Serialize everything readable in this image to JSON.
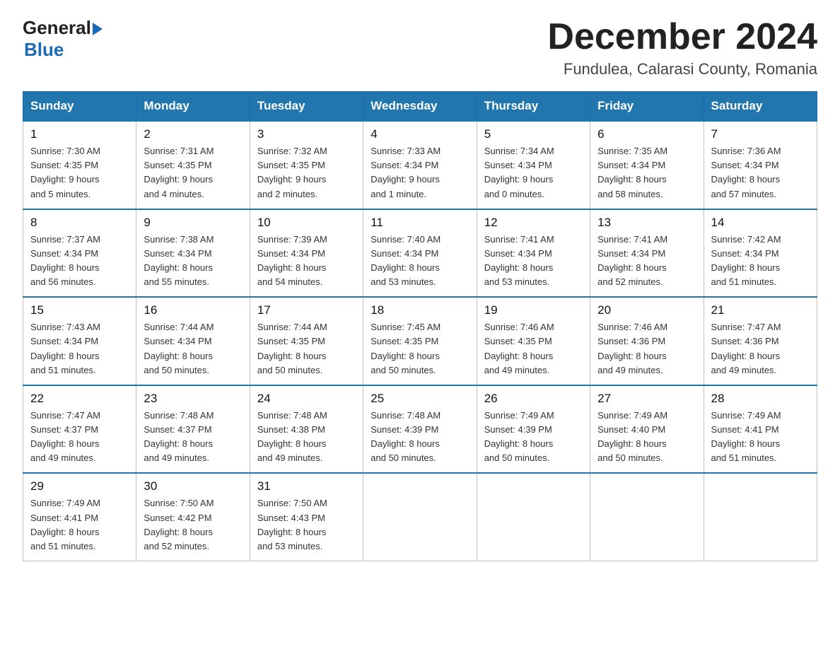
{
  "header": {
    "logo_general": "General",
    "logo_blue": "Blue",
    "title": "December 2024",
    "subtitle": "Fundulea, Calarasi County, Romania"
  },
  "days_of_week": [
    "Sunday",
    "Monday",
    "Tuesday",
    "Wednesday",
    "Thursday",
    "Friday",
    "Saturday"
  ],
  "weeks": [
    [
      {
        "num": "1",
        "sunrise": "7:30 AM",
        "sunset": "4:35 PM",
        "daylight": "9 hours and 5 minutes."
      },
      {
        "num": "2",
        "sunrise": "7:31 AM",
        "sunset": "4:35 PM",
        "daylight": "9 hours and 4 minutes."
      },
      {
        "num": "3",
        "sunrise": "7:32 AM",
        "sunset": "4:35 PM",
        "daylight": "9 hours and 2 minutes."
      },
      {
        "num": "4",
        "sunrise": "7:33 AM",
        "sunset": "4:34 PM",
        "daylight": "9 hours and 1 minute."
      },
      {
        "num": "5",
        "sunrise": "7:34 AM",
        "sunset": "4:34 PM",
        "daylight": "9 hours and 0 minutes."
      },
      {
        "num": "6",
        "sunrise": "7:35 AM",
        "sunset": "4:34 PM",
        "daylight": "8 hours and 58 minutes."
      },
      {
        "num": "7",
        "sunrise": "7:36 AM",
        "sunset": "4:34 PM",
        "daylight": "8 hours and 57 minutes."
      }
    ],
    [
      {
        "num": "8",
        "sunrise": "7:37 AM",
        "sunset": "4:34 PM",
        "daylight": "8 hours and 56 minutes."
      },
      {
        "num": "9",
        "sunrise": "7:38 AM",
        "sunset": "4:34 PM",
        "daylight": "8 hours and 55 minutes."
      },
      {
        "num": "10",
        "sunrise": "7:39 AM",
        "sunset": "4:34 PM",
        "daylight": "8 hours and 54 minutes."
      },
      {
        "num": "11",
        "sunrise": "7:40 AM",
        "sunset": "4:34 PM",
        "daylight": "8 hours and 53 minutes."
      },
      {
        "num": "12",
        "sunrise": "7:41 AM",
        "sunset": "4:34 PM",
        "daylight": "8 hours and 53 minutes."
      },
      {
        "num": "13",
        "sunrise": "7:41 AM",
        "sunset": "4:34 PM",
        "daylight": "8 hours and 52 minutes."
      },
      {
        "num": "14",
        "sunrise": "7:42 AM",
        "sunset": "4:34 PM",
        "daylight": "8 hours and 51 minutes."
      }
    ],
    [
      {
        "num": "15",
        "sunrise": "7:43 AM",
        "sunset": "4:34 PM",
        "daylight": "8 hours and 51 minutes."
      },
      {
        "num": "16",
        "sunrise": "7:44 AM",
        "sunset": "4:34 PM",
        "daylight": "8 hours and 50 minutes."
      },
      {
        "num": "17",
        "sunrise": "7:44 AM",
        "sunset": "4:35 PM",
        "daylight": "8 hours and 50 minutes."
      },
      {
        "num": "18",
        "sunrise": "7:45 AM",
        "sunset": "4:35 PM",
        "daylight": "8 hours and 50 minutes."
      },
      {
        "num": "19",
        "sunrise": "7:46 AM",
        "sunset": "4:35 PM",
        "daylight": "8 hours and 49 minutes."
      },
      {
        "num": "20",
        "sunrise": "7:46 AM",
        "sunset": "4:36 PM",
        "daylight": "8 hours and 49 minutes."
      },
      {
        "num": "21",
        "sunrise": "7:47 AM",
        "sunset": "4:36 PM",
        "daylight": "8 hours and 49 minutes."
      }
    ],
    [
      {
        "num": "22",
        "sunrise": "7:47 AM",
        "sunset": "4:37 PM",
        "daylight": "8 hours and 49 minutes."
      },
      {
        "num": "23",
        "sunrise": "7:48 AM",
        "sunset": "4:37 PM",
        "daylight": "8 hours and 49 minutes."
      },
      {
        "num": "24",
        "sunrise": "7:48 AM",
        "sunset": "4:38 PM",
        "daylight": "8 hours and 49 minutes."
      },
      {
        "num": "25",
        "sunrise": "7:48 AM",
        "sunset": "4:39 PM",
        "daylight": "8 hours and 50 minutes."
      },
      {
        "num": "26",
        "sunrise": "7:49 AM",
        "sunset": "4:39 PM",
        "daylight": "8 hours and 50 minutes."
      },
      {
        "num": "27",
        "sunrise": "7:49 AM",
        "sunset": "4:40 PM",
        "daylight": "8 hours and 50 minutes."
      },
      {
        "num": "28",
        "sunrise": "7:49 AM",
        "sunset": "4:41 PM",
        "daylight": "8 hours and 51 minutes."
      }
    ],
    [
      {
        "num": "29",
        "sunrise": "7:49 AM",
        "sunset": "4:41 PM",
        "daylight": "8 hours and 51 minutes."
      },
      {
        "num": "30",
        "sunrise": "7:50 AM",
        "sunset": "4:42 PM",
        "daylight": "8 hours and 52 minutes."
      },
      {
        "num": "31",
        "sunrise": "7:50 AM",
        "sunset": "4:43 PM",
        "daylight": "8 hours and 53 minutes."
      },
      null,
      null,
      null,
      null
    ]
  ],
  "labels": {
    "sunrise": "Sunrise:",
    "sunset": "Sunset:",
    "daylight": "Daylight:"
  }
}
